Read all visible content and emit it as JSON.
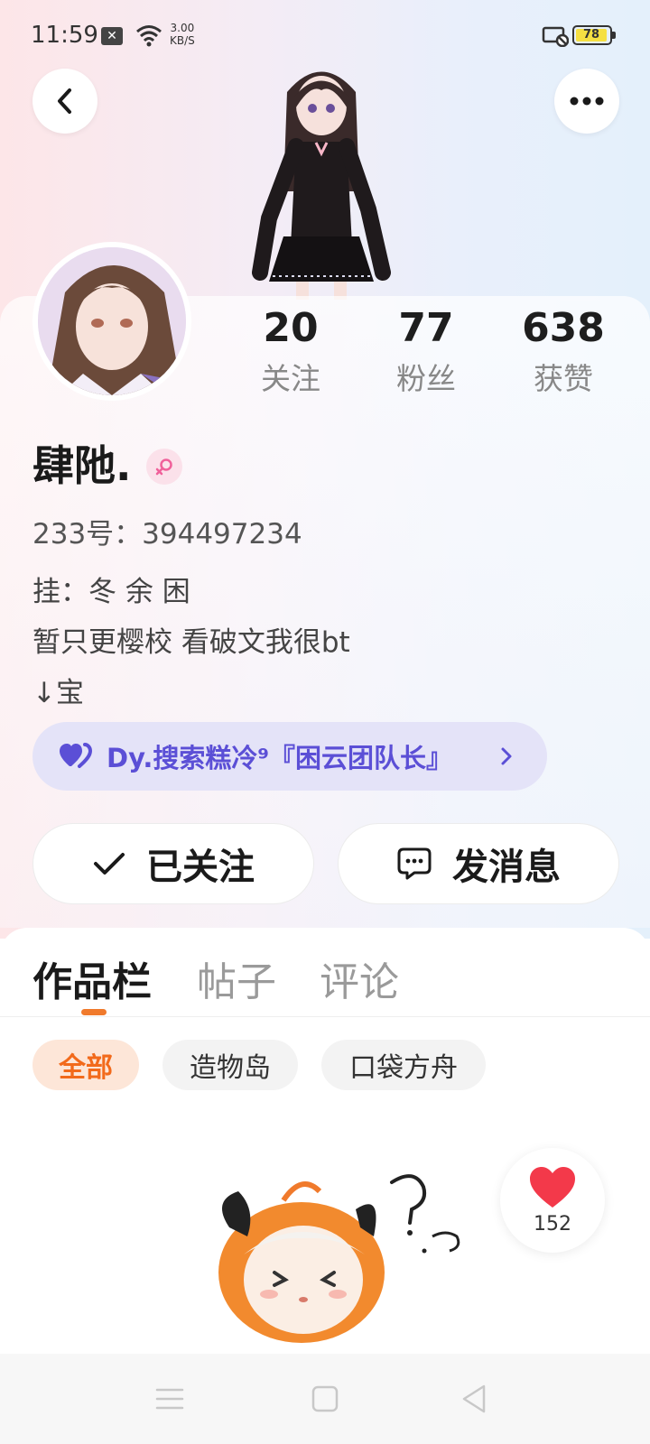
{
  "status_bar": {
    "time": "11:59",
    "net_speed_value": "3.00",
    "net_speed_unit": "KB/S",
    "battery": "78",
    "icons": [
      "notification-x-icon",
      "wifi-icon",
      "cast-off-icon",
      "battery-icon"
    ]
  },
  "header": {
    "back_icon": "chevron-left-icon",
    "more_icon": "more-dots-icon"
  },
  "profile": {
    "username": "肆阤.",
    "gender": "female",
    "uid": "233号：394497234",
    "bio_lines": [
      "挂：冬 余 困",
      "暂只更樱校 看破文我很bt",
      "↓宝"
    ],
    "link_chip": "Dy.搜索糕冷⁹『困云团队长』",
    "stats": [
      {
        "value": "20",
        "label": "关注"
      },
      {
        "value": "77",
        "label": "粉丝"
      },
      {
        "value": "638",
        "label": "获赞"
      }
    ]
  },
  "actions": {
    "follow_label": "已关注",
    "message_label": "发消息"
  },
  "tabs": [
    {
      "label": "作品栏",
      "active": true
    },
    {
      "label": "帖子",
      "active": false
    },
    {
      "label": "评论",
      "active": false
    }
  ],
  "filters": [
    {
      "label": "全部",
      "active": true
    },
    {
      "label": "造物岛",
      "active": false
    },
    {
      "label": "口袋方舟",
      "active": false
    }
  ],
  "like_float": {
    "count": "152"
  },
  "colors": {
    "accent_orange": "#f07a2c",
    "link_purple": "#5b4fd6",
    "female_pink": "#f0609a"
  },
  "nav_bar": [
    "menu-icon",
    "home-square-icon",
    "back-triangle-icon"
  ]
}
